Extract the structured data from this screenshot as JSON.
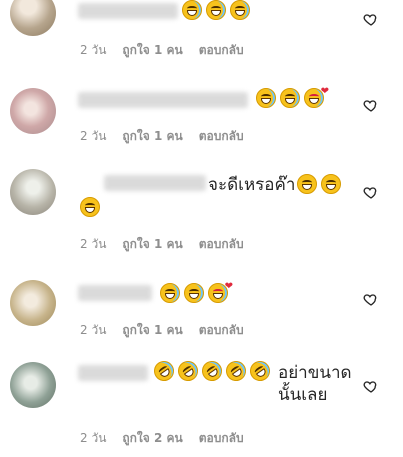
{
  "comments": [
    {
      "text": "",
      "emojis": [
        "laugh",
        "laugh",
        "laugh"
      ],
      "meta": {
        "time": "2 วัน",
        "likes": "ถูกใจ 1 คน",
        "reply": "ตอบกลับ"
      }
    },
    {
      "text": "",
      "emojis": [
        "laugh",
        "laugh",
        "laugh-heart"
      ],
      "meta": {
        "time": "2 วัน",
        "likes": "ถูกใจ 1 คน",
        "reply": "ตอบกลับ"
      }
    },
    {
      "text": "จะดีเหรอค๊า",
      "emojis": [
        "grin",
        "grin",
        "grin"
      ],
      "meta": {
        "time": "2 วัน",
        "likes": "ถูกใจ 1 คน",
        "reply": "ตอบกลับ"
      }
    },
    {
      "text": "",
      "emojis": [
        "laugh",
        "laugh",
        "laugh-heart"
      ],
      "meta": {
        "time": "2 วัน",
        "likes": "ถูกใจ 1 คน",
        "reply": "ตอบกลับ"
      }
    },
    {
      "text": "อย่าขนาด\nนั้นเลย",
      "emojis": [
        "rolling",
        "rolling",
        "rolling",
        "rolling",
        "rolling"
      ],
      "meta": {
        "time": "2 วัน",
        "likes": "ถูกใจ 2 คน",
        "reply": "ตอบกลับ"
      }
    }
  ]
}
